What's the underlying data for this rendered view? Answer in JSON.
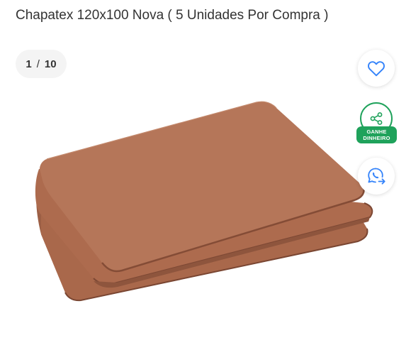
{
  "product": {
    "title": "Chapatex 120x100 Nova ( 5 Unidades Por Compra )"
  },
  "gallery": {
    "current": "1",
    "separator": "/",
    "total": "10",
    "image_alt": "Chapatex 120x100 Nova",
    "image_color": "#b57659"
  },
  "actions": {
    "favorite_icon": "heart-icon",
    "share_icon": "share-icon",
    "share_badge_line1": "GANHE",
    "share_badge_line2": "DINHEIRO",
    "whatsapp_icon": "whatsapp-icon"
  },
  "colors": {
    "accent_blue": "#3483fa",
    "share_green": "#1fa25b",
    "text": "#333333"
  }
}
